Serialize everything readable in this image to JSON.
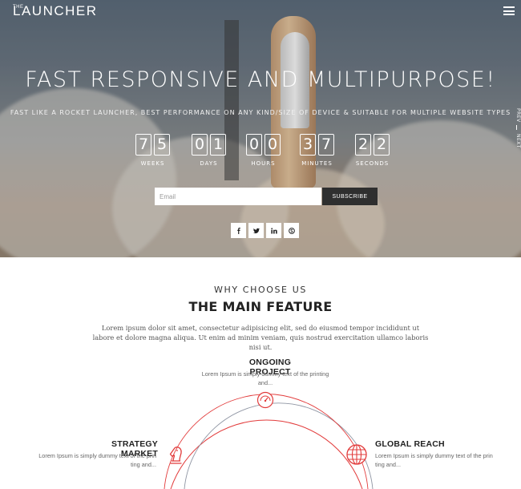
{
  "header": {
    "logo_small": "THE",
    "logo_main": "LAUNCHER",
    "menu_icon": "hamburger-menu-icon"
  },
  "hero": {
    "title": "FAST RESPONSIVE AND MULTIPURPOSE!",
    "subtitle": "FAST LIKE A ROCKET LAUNCHER, BEST PERFORMANCE ON ANY KIND/SIZE OF DEVICE & SUITABLE FOR MULTIPLE WEBSITE TYPES",
    "countdown": [
      {
        "label": "WEEKS",
        "digits": [
          "7",
          "5"
        ]
      },
      {
        "label": "DAYS",
        "digits": [
          "0",
          "1"
        ]
      },
      {
        "label": "HOURS",
        "digits": [
          "0",
          "0"
        ]
      },
      {
        "label": "MINUTES",
        "digits": [
          "3",
          "7"
        ]
      },
      {
        "label": "SECONDS",
        "digits": [
          "2",
          "2"
        ]
      }
    ],
    "email_placeholder": "Email",
    "subscribe_label": "SUBSCRIBE",
    "socials": [
      {
        "name": "facebook-icon",
        "glyph": "f"
      },
      {
        "name": "twitter-icon",
        "glyph": "t"
      },
      {
        "name": "linkedin-icon",
        "glyph": "in"
      },
      {
        "name": "skype-icon",
        "glyph": "s"
      }
    ],
    "side_nav": {
      "prev": "PREV",
      "next": "NEXT"
    }
  },
  "features": {
    "eyebrow": "WHY CHOOSE US",
    "heading": "THE MAIN FEATURE",
    "intro": "Lorem ipsum dolor sit amet, consectetur adipisicing elit, sed do eiusmod tempor incididunt ut labore et dolore magna aliqua. Ut enim ad minim veniam, quis nostrud exercitation ullamco laboris nisi ut.",
    "items": [
      {
        "title": "ONGOING PROJECT",
        "text": "Lorem Ipsum is simply dummy text of the printing and...",
        "icon": "gauge-icon"
      },
      {
        "title": "STRATEGY MARKET",
        "text": "Lorem Ipsum is simply dummy text of the prin ting and...",
        "icon": "chess-knight-icon"
      },
      {
        "title": "GLOBAL REACH",
        "text": "Lorem Ipsum is simply dummy text of the prin ting and...",
        "icon": "globe-icon"
      }
    ]
  },
  "colors": {
    "accent": "#e23b3b",
    "arc_grey": "#8f95a3",
    "button_dark": "#2f2f2f"
  }
}
